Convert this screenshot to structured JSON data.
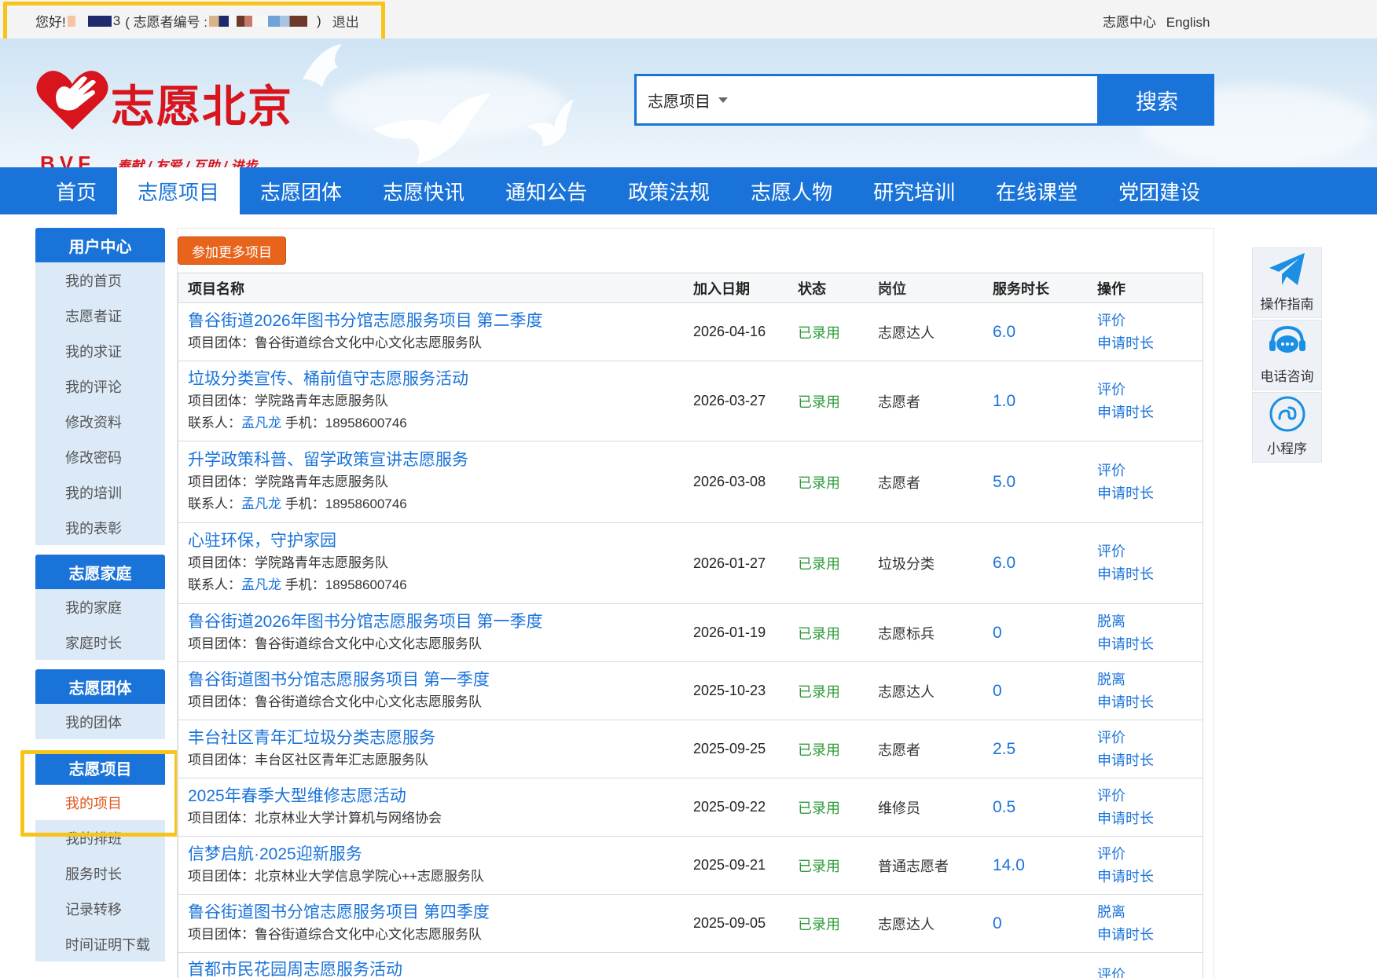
{
  "topbar": {
    "greeting": "您好! ",
    "user_suffix": "3",
    "volunteer_label": "( 志愿者编号 :",
    "close_paren": ")",
    "logout": "退出",
    "center": "志愿中心",
    "english": "English"
  },
  "header": {
    "logo_name": "志愿北京",
    "logo_abbr": "BVF",
    "slogan": "奉献 / 友爱 / 互助 / 进步",
    "search_scope": "志愿项目",
    "search_button": "搜索"
  },
  "nav": {
    "items": [
      "首页",
      "志愿项目",
      "志愿团体",
      "志愿快讯",
      "通知公告",
      "政策法规",
      "志愿人物",
      "研究培训",
      "在线课堂",
      "党团建设"
    ],
    "active": "志愿项目"
  },
  "sidebar": {
    "groups": [
      {
        "title": "用户中心",
        "items": [
          "我的首页",
          "志愿者证",
          "我的求证",
          "我的评论",
          "修改资料",
          "修改密码",
          "我的培训",
          "我的表彰"
        ]
      },
      {
        "title": "志愿家庭",
        "items": [
          "我的家庭",
          "家庭时长"
        ]
      },
      {
        "title": "志愿团体",
        "items": [
          "我的团体"
        ]
      },
      {
        "title": "志愿项目",
        "items": [
          "我的项目",
          "我的排班",
          "服务时长",
          "记录转移",
          "时间证明下载"
        ]
      }
    ],
    "active_item": "我的项目"
  },
  "main": {
    "join_button": "参加更多项目",
    "headers": {
      "name": "项目名称",
      "date": "加入日期",
      "status": "状态",
      "post": "岗位",
      "hours": "服务时长",
      "ops": "操作"
    },
    "team_label": "项目团体：",
    "contact_label": "联系人：",
    "phone_label": "手机：",
    "rows": [
      {
        "title": "鲁谷街道2026年图书分馆志愿服务项目 第二季度",
        "team": "鲁谷街道综合文化中心文化志愿服务队",
        "contact": "",
        "phone": "",
        "date": "2026-04-16",
        "status": "已录用",
        "post": "志愿达人",
        "hours": "6.0",
        "op1": "评价",
        "op2": "申请时长"
      },
      {
        "title": "垃圾分类宣传、桶前值守志愿服务活动",
        "team": "学院路青年志愿服务队",
        "contact": "孟凡龙",
        "phone": "18958600746",
        "date": "2026-03-27",
        "status": "已录用",
        "post": "志愿者",
        "hours": "1.0",
        "op1": "评价",
        "op2": "申请时长"
      },
      {
        "title": "升学政策科普、留学政策宣讲志愿服务",
        "team": "学院路青年志愿服务队",
        "contact": "孟凡龙",
        "phone": "18958600746",
        "date": "2026-03-08",
        "status": "已录用",
        "post": "志愿者",
        "hours": "5.0",
        "op1": "评价",
        "op2": "申请时长"
      },
      {
        "title": "心驻环保，守护家园",
        "team": "学院路青年志愿服务队",
        "contact": "孟凡龙",
        "phone": "18958600746",
        "date": "2026-01-27",
        "status": "已录用",
        "post": "垃圾分类",
        "hours": "6.0",
        "op1": "评价",
        "op2": "申请时长"
      },
      {
        "title": "鲁谷街道2026年图书分馆志愿服务项目 第一季度",
        "team": "鲁谷街道综合文化中心文化志愿服务队",
        "contact": "",
        "phone": "",
        "date": "2026-01-19",
        "status": "已录用",
        "post": "志愿标兵",
        "hours": "0",
        "op1": "脱离",
        "op2": "申请时长"
      },
      {
        "title": "鲁谷街道图书分馆志愿服务项目 第一季度",
        "team": "鲁谷街道综合文化中心文化志愿服务队",
        "contact": "",
        "phone": "",
        "date": "2025-10-23",
        "status": "已录用",
        "post": "志愿达人",
        "hours": "0",
        "op1": "脱离",
        "op2": "申请时长"
      },
      {
        "title": "丰台社区青年汇垃圾分类志愿服务",
        "team": "丰台区社区青年汇志愿服务队",
        "contact": "",
        "phone": "",
        "date": "2025-09-25",
        "status": "已录用",
        "post": "志愿者",
        "hours": "2.5",
        "op1": "评价",
        "op2": "申请时长"
      },
      {
        "title": "2025年春季大型维修志愿活动",
        "team": "北京林业大学计算机与网络协会",
        "contact": "",
        "phone": "",
        "date": "2025-09-22",
        "status": "已录用",
        "post": "维修员",
        "hours": "0.5",
        "op1": "评价",
        "op2": "申请时长"
      },
      {
        "title": "信梦启航·2025迎新服务",
        "team": "北京林业大学信息学院心++志愿服务队",
        "contact": "",
        "phone": "",
        "date": "2025-09-21",
        "status": "已录用",
        "post": "普通志愿者",
        "hours": "14.0",
        "op1": "评价",
        "op2": "申请时长"
      },
      {
        "title": "鲁谷街道图书分馆志愿服务项目 第四季度",
        "team": "鲁谷街道综合文化中心文化志愿服务队",
        "contact": "",
        "phone": "",
        "date": "2025-09-05",
        "status": "已录用",
        "post": "志愿达人",
        "hours": "0",
        "op1": "脱离",
        "op2": "申请时长"
      },
      {
        "title": "首都市民花园周志愿服务活动",
        "team": "",
        "contact": "",
        "phone": "",
        "date": "",
        "status": "",
        "post": "",
        "hours": "",
        "op1": "评价",
        "op2": ""
      }
    ]
  },
  "floatbar": {
    "items": [
      {
        "label": "操作指南",
        "icon": "paper-plane-icon"
      },
      {
        "label": "电话咨询",
        "icon": "chat-headset-icon"
      },
      {
        "label": "小程序",
        "icon": "mini-program-icon"
      }
    ]
  },
  "colors": {
    "primary": "#1a73d9",
    "accent_orange": "#e8641c",
    "status_green": "#2e9c3a",
    "logo_red": "#d8141d",
    "highlight": "#f7c41c"
  }
}
